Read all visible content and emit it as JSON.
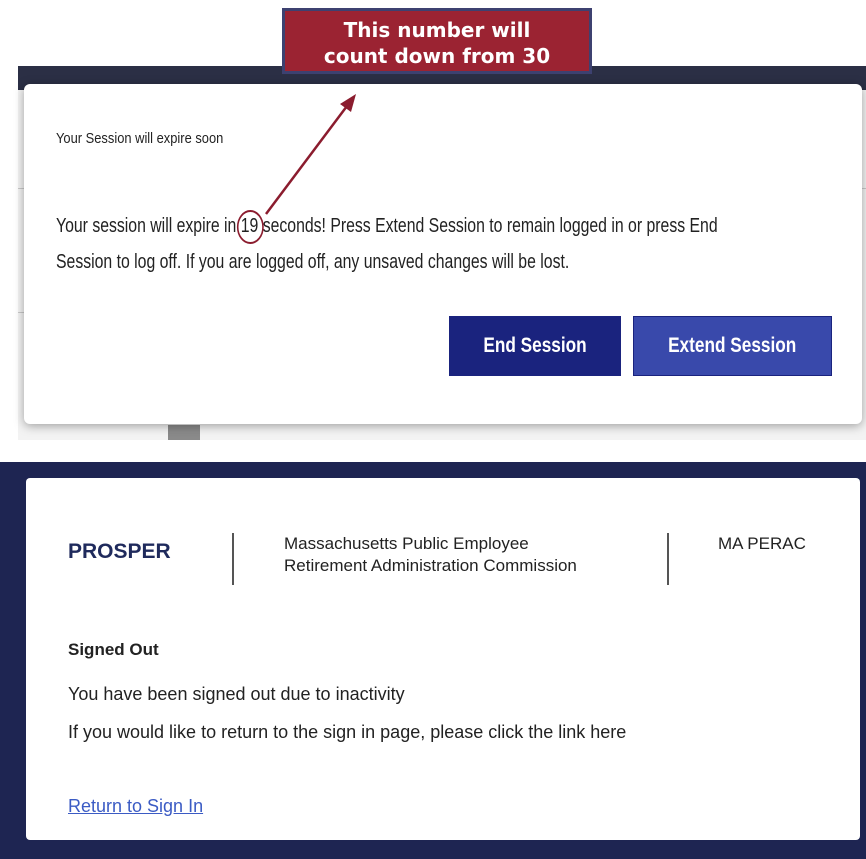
{
  "callout": {
    "line1": "This number will",
    "line2": "count down from 30"
  },
  "session_modal": {
    "title": "Your Session will expire soon",
    "message_before": "Your session will expire in ",
    "countdown": "19",
    "message_after": " seconds! Press Extend Session to remain logged in or press End Session to log off. If you are logged off, any unsaved changes will be lost.",
    "end_button": "End Session",
    "extend_button": "Extend Session"
  },
  "signed_out": {
    "brand": "PROSPER",
    "commission_line1": "Massachusetts Public Employee",
    "commission_line2": "Retirement Administration Commission",
    "org_short": "MA PERAC",
    "title": "Signed Out",
    "message1": "You have been signed out due to inactivity",
    "message2": "If you would like to return to the sign in page, please click the link here",
    "link": "Return to Sign In"
  },
  "colors": {
    "callout_bg": "#9b2332",
    "end_button": "#1a237e",
    "extend_button": "#3949ab",
    "page_frame": "#1e2552",
    "link": "#3b5bc4"
  }
}
